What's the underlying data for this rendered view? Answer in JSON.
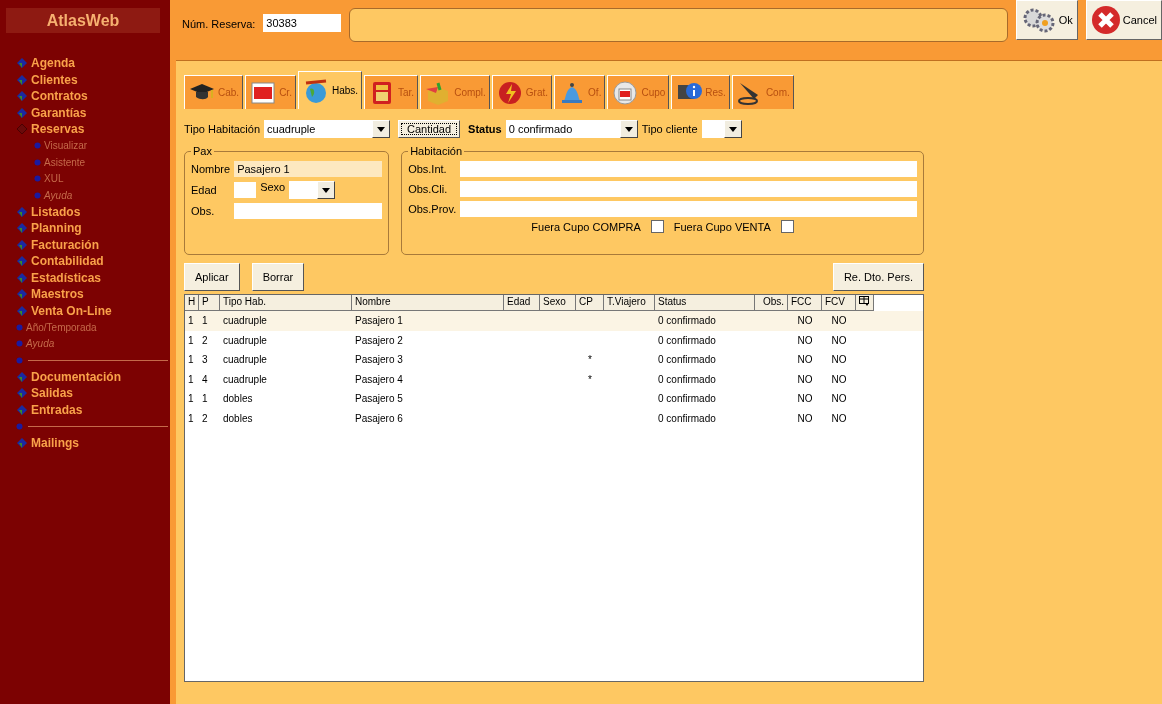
{
  "sidebar": {
    "title": "AtlasWeb",
    "items": [
      {
        "kind": "main",
        "label": "Agenda"
      },
      {
        "kind": "main",
        "label": "Clientes"
      },
      {
        "kind": "main",
        "label": "Contratos"
      },
      {
        "kind": "main",
        "label": "Garantías"
      },
      {
        "kind": "main",
        "label": "Reservas",
        "expanded": true,
        "children": [
          {
            "kind": "sub",
            "label": "Visualizar"
          },
          {
            "kind": "sub",
            "label": "Asistente"
          },
          {
            "kind": "sub",
            "label": "XUL"
          },
          {
            "kind": "help",
            "label": "Ayuda"
          }
        ]
      },
      {
        "kind": "main",
        "label": "Listados"
      },
      {
        "kind": "main",
        "label": "Planning"
      },
      {
        "kind": "main",
        "label": "Facturación"
      },
      {
        "kind": "main",
        "label": "Contabilidad"
      },
      {
        "kind": "main",
        "label": "Estadísticas"
      },
      {
        "kind": "main",
        "label": "Maestros"
      },
      {
        "kind": "main",
        "label": "Venta On-Line"
      },
      {
        "kind": "sub",
        "label": "Año/Temporada"
      },
      {
        "kind": "help",
        "label": "Ayuda"
      },
      {
        "kind": "separator"
      },
      {
        "kind": "main",
        "label": "Documentación"
      },
      {
        "kind": "main",
        "label": "Salidas"
      },
      {
        "kind": "main",
        "label": "Entradas"
      },
      {
        "kind": "separator"
      },
      {
        "kind": "main",
        "label": "Mailings"
      }
    ]
  },
  "header": {
    "reserva_label": "Núm. Reserva:",
    "reserva_value": "30383",
    "ok_button": "Ok",
    "cancel_button": "Cancel"
  },
  "tabs": [
    {
      "label": "Cab.",
      "selected": false
    },
    {
      "label": "Cr.",
      "selected": false
    },
    {
      "label": "Habs.",
      "selected": true
    },
    {
      "label": "Tar.",
      "selected": false
    },
    {
      "label": "Compl.",
      "selected": false
    },
    {
      "label": "Grat.",
      "selected": false
    },
    {
      "label": "Of.",
      "selected": false
    },
    {
      "label": "Cupo",
      "selected": false
    },
    {
      "label": "Res.",
      "selected": false
    },
    {
      "label": "Com.",
      "selected": false
    }
  ],
  "filters": {
    "tipo_habitacion_label": "Tipo Habitación",
    "tipo_habitacion_value": "cuadruple",
    "cantidad_button": "Cantidad",
    "status_label": "Status",
    "status_value": "0 confirmado",
    "tipo_cliente_label": "Tipo cliente"
  },
  "pax": {
    "legend": "Pax",
    "nombre_label": "Nombre",
    "nombre_value": "Pasajero 1",
    "edad_label": "Edad",
    "sexo_label": "Sexo",
    "obs_label": "Obs."
  },
  "habitacion": {
    "legend": "Habitación",
    "obs_int_label": "Obs.Int.",
    "obs_cli_label": "Obs.Cli.",
    "obs_prov_label": "Obs.Prov.",
    "fuera_compra_label": "Fuera Cupo COMPRA",
    "fuera_compra_checked": false,
    "fuera_venta_label": "Fuera Cupo VENTA",
    "fuera_venta_checked": false
  },
  "buttons": {
    "aplicar": "Aplicar",
    "borrar": "Borrar",
    "re_dto": "Re. Dto. Pers."
  },
  "table": {
    "columns": [
      "H",
      "P",
      "Tipo Hab.",
      "Nombre",
      "Edad",
      "Sexo",
      "CP",
      "T.Viajero",
      "Status",
      "Obs.",
      "FCC",
      "FCV"
    ],
    "rows": [
      {
        "selected": true,
        "cells": [
          "1",
          "1",
          "cuadruple",
          "Pasajero 1",
          "",
          "",
          "",
          "",
          "0 confirmado",
          "",
          "NO",
          "NO"
        ]
      },
      {
        "selected": false,
        "cells": [
          "1",
          "2",
          "cuadruple",
          "Pasajero 2",
          "",
          "",
          "",
          "",
          "0 confirmado",
          "",
          "NO",
          "NO"
        ]
      },
      {
        "selected": false,
        "cells": [
          "1",
          "3",
          "cuadruple",
          "Pasajero 3",
          "",
          "",
          "*",
          "",
          "0 confirmado",
          "",
          "NO",
          "NO"
        ]
      },
      {
        "selected": false,
        "cells": [
          "1",
          "4",
          "cuadruple",
          "Pasajero 4",
          "",
          "",
          "*",
          "",
          "0 confirmado",
          "",
          "NO",
          "NO"
        ]
      },
      {
        "selected": false,
        "cells": [
          "1",
          "1",
          "dobles",
          "Pasajero 5",
          "",
          "",
          "",
          "",
          "0 confirmado",
          "",
          "NO",
          "NO"
        ]
      },
      {
        "selected": false,
        "cells": [
          "1",
          "2",
          "dobles",
          "Pasajero 6",
          "",
          "",
          "",
          "",
          "0 confirmado",
          "",
          "NO",
          "NO"
        ]
      }
    ]
  }
}
